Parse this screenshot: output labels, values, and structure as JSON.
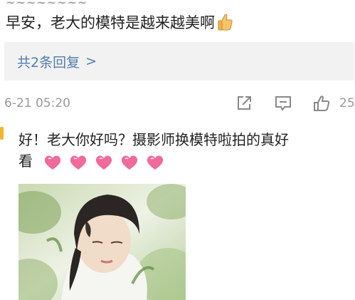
{
  "comment": {
    "partial_top_text": "~~~~~~~~",
    "text": "早安，老大的模特是越来越美啊",
    "thumb_icon": "thumbs-up-emoji"
  },
  "replies": {
    "label": "共2条回复",
    "chevron": ">"
  },
  "meta": {
    "timestamp": "6-21 05:20",
    "icons": [
      "share-icon",
      "comment-icon",
      "like-icon"
    ],
    "like_count": "25"
  },
  "reply": {
    "line1": "好！老大你好吗？摄影师换模特啦拍的真好",
    "line2": "看",
    "heart_count": 5,
    "heart_icon": "pink-heart-emoji"
  },
  "photo": {
    "description_icon": "photo-thumbnail"
  },
  "colors": {
    "link": "#507daf",
    "meta": "#999999",
    "heart": "#f06a9a",
    "box_bg": "#f2f2f2"
  }
}
